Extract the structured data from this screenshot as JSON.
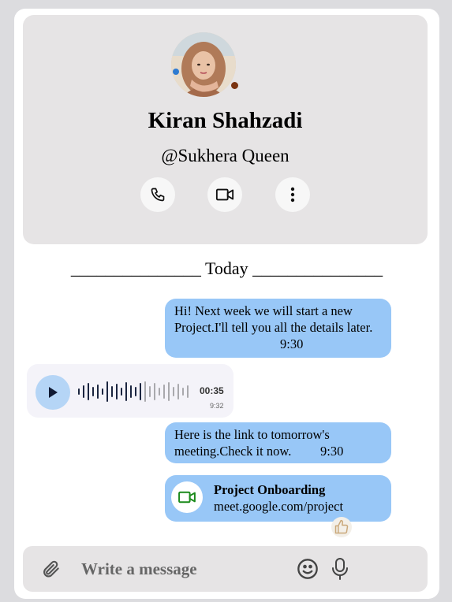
{
  "profile": {
    "name": "Kiran Shahzadi",
    "handle": "@Sukhera Queen",
    "status_color": "#7a3311",
    "actions": [
      {
        "icon": "phone-icon"
      },
      {
        "icon": "video-icon"
      },
      {
        "icon": "more-vertical-icon"
      }
    ]
  },
  "chat": {
    "divider_label": "_______________ Today _______________",
    "messages": [
      {
        "text": "Hi! Next week we will start a new Project.I'll tell you all the details later.",
        "time": "9:30"
      },
      {
        "voice_duration": "00:35",
        "time": "9:32"
      },
      {
        "text": "Here is the link to tomorrow's meeting.Check it now.",
        "time": "9:30"
      },
      {
        "title": "Project Onboarding",
        "link": "meet.google.com/project",
        "icon": "video-icon"
      }
    ],
    "reaction_icon": "thumbs-up-icon"
  },
  "composer": {
    "placeholder": "Write a message"
  },
  "colors": {
    "bubble": "#98c7f7",
    "panel": "#e6e4e5",
    "meet_green": "#1b8a1b"
  }
}
